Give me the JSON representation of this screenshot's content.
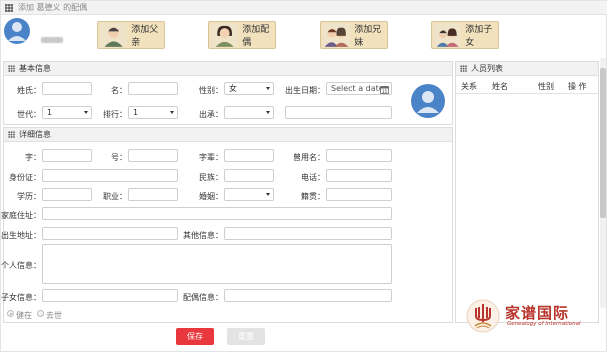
{
  "window": {
    "title": "添加 葛德义 的配偶"
  },
  "top_buttons": [
    {
      "label": "添加父亲"
    },
    {
      "label": "添加配偶"
    },
    {
      "label": "添加兄妹"
    },
    {
      "label": "添加子女"
    }
  ],
  "basic": {
    "header": "基本信息",
    "surname_label": "姓氏：",
    "given_label": "名：",
    "gender_label": "性别：",
    "gender_value": "女",
    "birth_label": "出生日期：",
    "birth_placeholder": "Select a date",
    "generation_label": "世代：",
    "generation_value": "1",
    "rank_label": "排行：",
    "rank_value": "1",
    "lineage_label": "出承：",
    "lineage_value": ""
  },
  "detail": {
    "header": "详细信息",
    "zi_label": "字：",
    "hao_label": "号：",
    "zibei_label": "字辈：",
    "former_name_label": "曾用名：",
    "id_label": "身份证：",
    "ethnic_label": "民族：",
    "phone_label": "电话：",
    "edu_label": "学历：",
    "job_label": "职业：",
    "marriage_label": "婚姻：",
    "native_label": "籍贯：",
    "home_label": "家庭住址：",
    "birthplace_label": "出生地址：",
    "other_label": "其他信息：",
    "personal_label": "个人信息：",
    "children_label": "子女信息：",
    "spouse_label": "配偶信息：",
    "alive_label": "健在",
    "dead_label": "去世"
  },
  "members": {
    "header": "人员列表",
    "columns": [
      "关系",
      "姓名",
      "性别",
      "操 作"
    ]
  },
  "actions": {
    "save_label": "保存",
    "reset_label": "重置"
  },
  "logo": {
    "title": "家谱国际",
    "subtitle": "Genealogy of International"
  }
}
